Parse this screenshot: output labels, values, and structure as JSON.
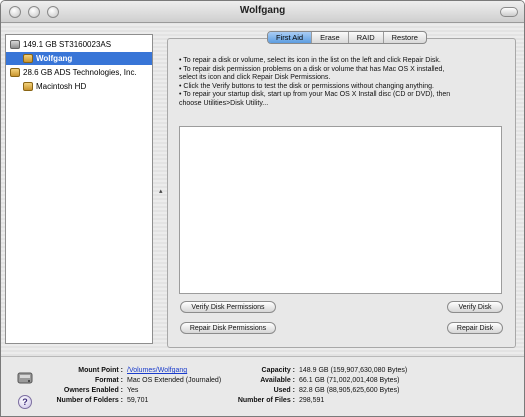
{
  "window": {
    "title": "Wolfgang"
  },
  "disks": [
    {
      "label": "149.1 GB ST3160023AS",
      "icon": "hard-drive-icon",
      "selected": false,
      "indent": 0
    },
    {
      "label": "Wolfgang",
      "icon": "volume-icon",
      "selected": true,
      "indent": 1
    },
    {
      "label": "28.6 GB ADS Technologies, Inc.",
      "icon": "external-drive-icon",
      "selected": false,
      "indent": 0
    },
    {
      "label": "Macintosh HD",
      "icon": "volume-icon",
      "selected": false,
      "indent": 1
    }
  ],
  "tabs": [
    {
      "label": "First Aid",
      "active": true
    },
    {
      "label": "Erase",
      "active": false
    },
    {
      "label": "RAID",
      "active": false
    },
    {
      "label": "Restore",
      "active": false
    }
  ],
  "instructions": [
    "• To repair a disk or volume, select its icon in the list on the left and click Repair Disk.",
    "• To repair disk permission problems on a disk or volume that has Mac OS X installed,",
    "select its icon and click Repair Disk Permissions.",
    "• Click the Verify buttons to test the disk or permissions without changing anything.",
    "• To repair your startup disk, start up from your Mac OS X Install disc (CD or DVD), then",
    "choose Utilities>Disk Utility..."
  ],
  "buttons": {
    "verify_permissions": "Verify Disk Permissions",
    "repair_permissions": "Repair Disk Permissions",
    "verify_disk": "Verify Disk",
    "repair_disk": "Repair Disk"
  },
  "info": {
    "mount_point_label": "Mount Point :",
    "mount_point": "/Volumes/Wolfgang",
    "format_label": "Format :",
    "format": "Mac OS Extended (Journaled)",
    "owners_label": "Owners Enabled :",
    "owners": "Yes",
    "folders_label": "Number of Folders :",
    "folders": "59,701",
    "capacity_label": "Capacity :",
    "capacity": "148.9 GB (159,907,630,080 Bytes)",
    "available_label": "Available :",
    "available": "66.1 GB (71,002,001,408 Bytes)",
    "used_label": "Used :",
    "used": "82.8 GB (88,905,625,600 Bytes)",
    "files_label": "Number of Files :",
    "files": "298,591"
  },
  "help_glyph": "?",
  "splitter_glyph": "▴",
  "colors": {
    "selection": "#3875d7",
    "active_tab": "#5d9de0",
    "link": "#1a3ccc"
  }
}
